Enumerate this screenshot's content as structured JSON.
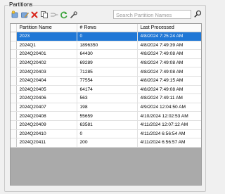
{
  "group": {
    "label": "Partitions"
  },
  "toolbar": {
    "buttons": [
      {
        "name": "new-partition-icon"
      },
      {
        "name": "edit-partition-icon"
      },
      {
        "name": "delete-icon"
      },
      {
        "name": "copy-icon"
      },
      {
        "name": "merge-icon"
      },
      {
        "name": "refresh-icon"
      },
      {
        "name": "wrench-icon"
      }
    ],
    "search_placeholder": "Search Partition Names"
  },
  "table": {
    "columns": [
      "Partition Name",
      "# Rows",
      "Last Processed"
    ],
    "selected_row": 0,
    "rows": [
      [
        "2023",
        "0",
        "4/8/2024 7:25:24 AM"
      ],
      [
        "2024Q1",
        "1896350",
        "4/8/2024 7:49:39 AM"
      ],
      [
        "2024Q20401",
        "64430",
        "4/8/2024 7:49:08 AM"
      ],
      [
        "2024Q20402",
        "69289",
        "4/8/2024 7:49:08 AM"
      ],
      [
        "2024Q20403",
        "71285",
        "4/8/2024 7:49:08 AM"
      ],
      [
        "2024Q20404",
        "77554",
        "4/8/2024 7:49:15 AM"
      ],
      [
        "2024Q20405",
        "64174",
        "4/8/2024 7:49:08 AM"
      ],
      [
        "2024Q20406",
        "563",
        "4/8/2024 7:49:11 AM"
      ],
      [
        "2024Q20407",
        "198",
        "4/9/2024 12:04:50 AM"
      ],
      [
        "2024Q20408",
        "55659",
        "4/10/2024 12:02:53 AM"
      ],
      [
        "2024Q20409",
        "63581",
        "4/11/2024 12:07:12 AM"
      ],
      [
        "2024Q20410",
        "0",
        "4/11/2024 6:56:54 AM"
      ],
      [
        "2024Q20411",
        "200",
        "4/11/2024 6:56:57 AM"
      ]
    ]
  },
  "colors": {
    "selection": "#1f77d6",
    "empty_area": "#aaaaaa",
    "delete": "#d9261c",
    "refresh": "#3aa33a"
  }
}
